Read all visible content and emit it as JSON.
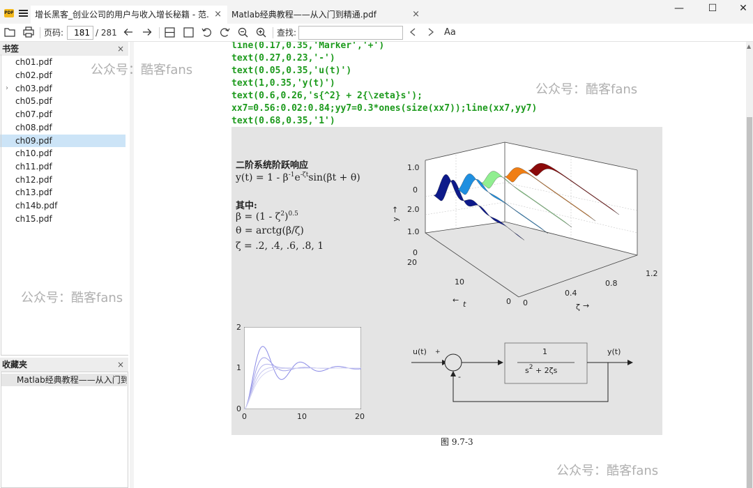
{
  "titlebar": {
    "tabs": [
      {
        "title": "增长黑客_创业公司的用户与收入增长秘籍 - 范...",
        "close": "×"
      },
      {
        "title": "Matlab经典教程——从入门到精通.pdf",
        "close": "×"
      }
    ],
    "window": {
      "minimize": "—",
      "maximize": "☐",
      "close": "✕"
    }
  },
  "toolbar": {
    "page_label": "页码:",
    "page_current": "181",
    "page_total": "/ 281",
    "find_label": "查找:",
    "font_button": "Aa"
  },
  "sidebar": {
    "bookmarks_title": "书签",
    "bookmarks_close": "×",
    "bookmarks": [
      {
        "label": "ch01.pdf"
      },
      {
        "label": "ch02.pdf"
      },
      {
        "label": "ch03.pdf",
        "expander": "›"
      },
      {
        "label": "ch05.pdf"
      },
      {
        "label": "ch07.pdf"
      },
      {
        "label": "ch08.pdf"
      },
      {
        "label": "ch09.pdf",
        "selected": true
      },
      {
        "label": "ch10.pdf"
      },
      {
        "label": "ch11.pdf"
      },
      {
        "label": "ch12.pdf"
      },
      {
        "label": "ch13.pdf"
      },
      {
        "label": "ch14b.pdf"
      },
      {
        "label": "ch15.pdf"
      }
    ],
    "favorites_title": "收藏夹",
    "favorites_close": "×",
    "favorites": [
      {
        "label": "Matlab经典教程——从入门到精"
      }
    ]
  },
  "document": {
    "code_lines": [
      "line(0.17,0.35,'Marker','+')",
      "text(0.27,0.23,'-')",
      "text(0.05,0.35,'u(t)')",
      "text(1,0.35,'y(t)')",
      "text(0.6,0.26,'s{^2} + 2{\\zeta}s');",
      "xx7=0.56:0.02:0.84;yy7=0.3*ones(size(xx7));line(xx7,yy7)",
      "text(0.68,0.35,'1')"
    ],
    "figure": {
      "heading": "二阶系统阶跃响应",
      "eq_y_a": "y(t) = 1 - β",
      "eq_y_sup1": "-1",
      "eq_y_b": "e",
      "eq_y_sup2": "-ζt",
      "eq_y_c": "sin(βt + θ)",
      "where": "其中:",
      "eq_beta_a": "β = (1 - ζ",
      "eq_beta_sup": "2",
      "eq_beta_b": ")",
      "eq_beta_sup2": "0.5",
      "eq_theta": "θ = arctg(β/ζ)",
      "eq_zeta": "ζ = .2, .4, .6, .8, 1",
      "surface": {
        "z_ticks_top": [
          "1.0",
          "0"
        ],
        "z_ticks_bottom": [
          "2.0",
          "1.0",
          "0"
        ],
        "y_axis_label": "y",
        "y_axis_arrow": "→",
        "t_ticks": [
          "20",
          "10",
          "0"
        ],
        "t_label": "t",
        "t_arrow": "←",
        "zeta_ticks": [
          "0",
          "0.4",
          "0.8",
          "1.2"
        ],
        "zeta_label": "ζ",
        "zeta_arrow": "→",
        "ribbon_colors": [
          "#0d1a8a",
          "#1f8fe0",
          "#90ee90",
          "#f07e14",
          "#8b0a0a"
        ]
      },
      "block": {
        "input": "u(t)",
        "output": "y(t)",
        "plus": "+",
        "minus": "-",
        "numerator": "1",
        "denominator_a": "s",
        "denominator_sup": "2",
        "denominator_b": " + 2ζs"
      }
    },
    "caption": "图 9.7-3"
  },
  "watermark": "公众号：酷客fans",
  "chart_data": [
    {
      "type": "line",
      "title": "",
      "xlabel": "",
      "ylabel": "",
      "xlim": [
        0,
        20
      ],
      "ylim": [
        0,
        2
      ],
      "x_ticks": [
        0,
        10,
        20
      ],
      "y_ticks": [
        0,
        1,
        2
      ],
      "series": [
        {
          "zeta": 0.2,
          "color": "#8a8ae6"
        },
        {
          "zeta": 0.4,
          "color": "#a0a0e8"
        },
        {
          "zeta": 0.6,
          "color": "#b4b4ec"
        },
        {
          "zeta": 0.8,
          "color": "#c6c6f0"
        },
        {
          "zeta": 1.0,
          "color": "#d4d4f2"
        }
      ]
    }
  ]
}
